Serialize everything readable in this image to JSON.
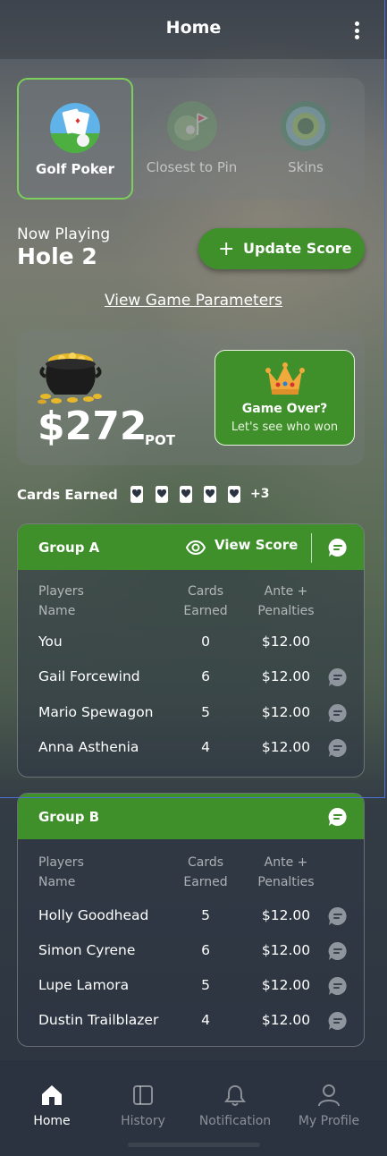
{
  "header": {
    "title": "Home"
  },
  "game_tabs": [
    {
      "label": "Golf Poker",
      "icon": "golf-poker-icon",
      "active": true
    },
    {
      "label": "Closest to Pin",
      "icon": "closest-to-pin-icon",
      "active": false
    },
    {
      "label": "Skins",
      "icon": "skins-icon",
      "active": false
    }
  ],
  "now_playing": {
    "label": "Now Playing",
    "hole": "Hole 2"
  },
  "update_score_button": {
    "label": "Update Score"
  },
  "view_params_link": {
    "label": "View Game Parameters"
  },
  "pot": {
    "amount": "$272",
    "label": "POT"
  },
  "game_over": {
    "title": "Game Over?",
    "subtitle": "Let's see who won"
  },
  "cards_earned": {
    "label": "Cards Earned",
    "extra": "+3",
    "icon_count": 5
  },
  "groups": [
    {
      "name": "Group A",
      "view_score_label": "View Score",
      "headers": {
        "player": [
          "Players",
          "Name"
        ],
        "cards": [
          "Cards",
          "Earned"
        ],
        "ante": [
          "Ante +",
          "Penalties"
        ]
      },
      "rows": [
        {
          "name": "You",
          "cards": "0",
          "ante": "$12.00",
          "chat": false
        },
        {
          "name": "Gail Forcewind",
          "cards": "6",
          "ante": "$12.00",
          "chat": true
        },
        {
          "name": "Mario Spewagon",
          "cards": "5",
          "ante": "$12.00",
          "chat": true
        },
        {
          "name": "Anna Asthenia",
          "cards": "4",
          "ante": "$12.00",
          "chat": true
        }
      ]
    },
    {
      "name": "Group B",
      "headers": {
        "player": [
          "Players",
          "Name"
        ],
        "cards": [
          "Cards",
          "Earned"
        ],
        "ante": [
          "Ante +",
          "Penalties"
        ]
      },
      "rows": [
        {
          "name": "Holly Goodhead",
          "cards": "5",
          "ante": "$12.00",
          "chat": true
        },
        {
          "name": "Simon Cyrene",
          "cards": "6",
          "ante": "$12.00",
          "chat": true
        },
        {
          "name": "Lupe Lamora",
          "cards": "5",
          "ante": "$12.00",
          "chat": true
        },
        {
          "name": "Dustin Trailblazer",
          "cards": "4",
          "ante": "$12.00",
          "chat": true
        }
      ]
    }
  ],
  "bottom_nav": [
    {
      "label": "Home",
      "icon": "home-icon",
      "active": true
    },
    {
      "label": "History",
      "icon": "history-icon",
      "active": false
    },
    {
      "label": "Notification",
      "icon": "bell-icon",
      "active": false
    },
    {
      "label": "My Profile",
      "icon": "user-icon",
      "active": false
    }
  ],
  "colors": {
    "accent_green": "#3f8f2a",
    "active_border": "#7ccf5a",
    "nav_bg": "#2b3340",
    "crown": "#f2a93b"
  }
}
